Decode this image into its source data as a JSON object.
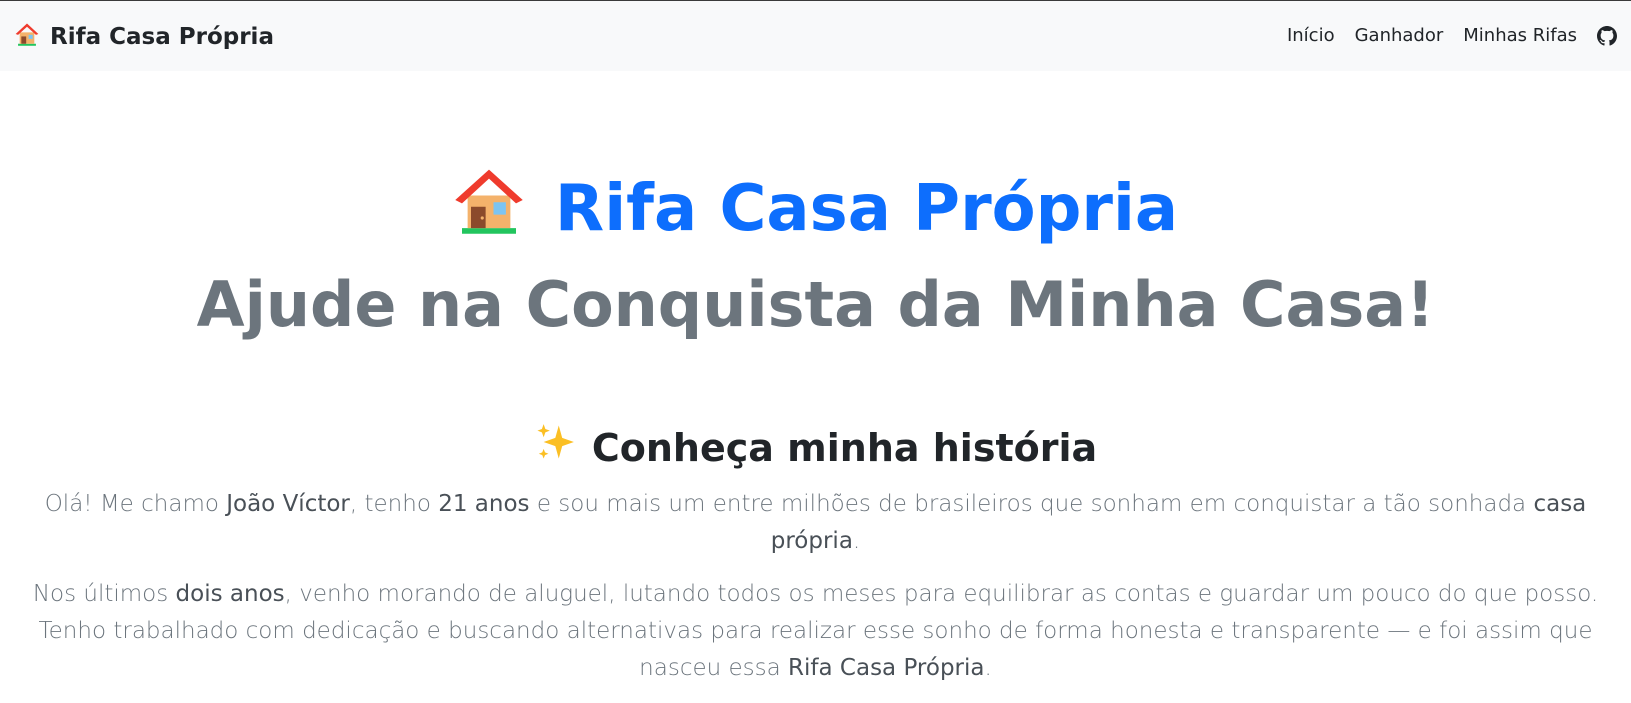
{
  "navbar": {
    "brand_icon": "house-emoji",
    "brand_label": "Rifa Casa Própria",
    "links": [
      "Início",
      "Ganhador",
      "Minhas Rifas"
    ],
    "github_icon": "github-icon"
  },
  "hero": {
    "icon": "house-emoji",
    "title": "Rifa Casa Própria",
    "subtitle": "Ajude na Conquista da Minha Casa!",
    "title_color": "#0d6efd",
    "subtitle_color": "#6c757d"
  },
  "story": {
    "icon": "sparkles-emoji",
    "title": "Conheça minha história",
    "p1": {
      "t1": "Olá! Me chamo ",
      "b1": "João Víctor",
      "t2": ", tenho ",
      "b2": "21 anos",
      "t3": " e sou mais um entre milhões de brasileiros que sonham em conquistar a tão sonhada ",
      "b3": "casa própria",
      "t4": "."
    },
    "p2": {
      "t1": "Nos últimos ",
      "b1": "dois anos",
      "t2": ", venho morando de aluguel, lutando todos os meses para equilibrar as contas e guardar um pouco do que posso. Tenho trabalhado com dedicação e buscando alternativas para realizar esse sonho de forma honesta e transparente — e foi assim que nasceu essa ",
      "b2": "Rifa Casa Própria",
      "t3": "."
    }
  }
}
